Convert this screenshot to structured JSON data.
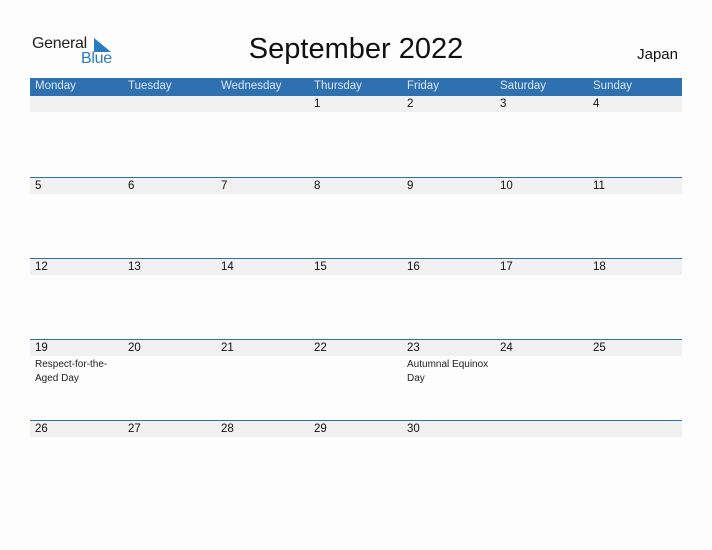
{
  "logo": {
    "general": "General",
    "blue": "Blue",
    "icon": "triangle-flag-icon",
    "brand_color": "#2a7ac0"
  },
  "title": "September 2022",
  "country": "Japan",
  "colors": {
    "header_bg": "#2e70b0",
    "date_strip_bg": "#f1f1f1"
  },
  "weekdays": [
    "Monday",
    "Tuesday",
    "Wednesday",
    "Thursday",
    "Friday",
    "Saturday",
    "Sunday"
  ],
  "weeks": [
    {
      "days": [
        "",
        "",
        "",
        "1",
        "2",
        "3",
        "4"
      ],
      "holidays": [
        "",
        "",
        "",
        "",
        "",
        "",
        ""
      ]
    },
    {
      "days": [
        "5",
        "6",
        "7",
        "8",
        "9",
        "10",
        "11"
      ],
      "holidays": [
        "",
        "",
        "",
        "",
        "",
        "",
        ""
      ]
    },
    {
      "days": [
        "12",
        "13",
        "14",
        "15",
        "16",
        "17",
        "18"
      ],
      "holidays": [
        "",
        "",
        "",
        "",
        "",
        "",
        ""
      ]
    },
    {
      "days": [
        "19",
        "20",
        "21",
        "22",
        "23",
        "24",
        "25"
      ],
      "holidays": [
        "Respect-for-the-Aged Day",
        "",
        "",
        "",
        "Autumnal Equinox Day",
        "",
        ""
      ]
    },
    {
      "days": [
        "26",
        "27",
        "28",
        "29",
        "30",
        "",
        ""
      ],
      "holidays": [
        "",
        "",
        "",
        "",
        "",
        "",
        ""
      ]
    }
  ]
}
